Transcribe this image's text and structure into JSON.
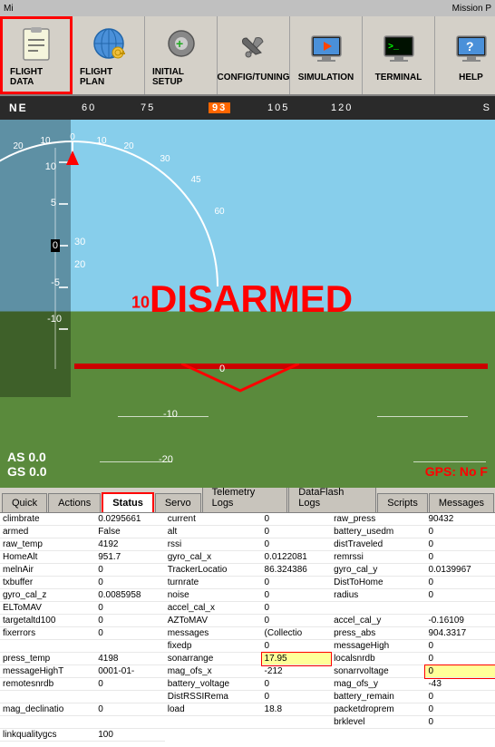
{
  "topbar": {
    "left": "Mi",
    "right": "Mission P"
  },
  "nav": {
    "items": [
      {
        "label": "FLIGHT DATA",
        "active": true,
        "icon": "clipboard"
      },
      {
        "label": "FLIGHT PLAN",
        "active": false,
        "icon": "globe"
      },
      {
        "label": "INITIAL SETUP",
        "active": false,
        "icon": "gear-plus"
      },
      {
        "label": "CONFIG/TUNING",
        "active": false,
        "icon": "wrench"
      },
      {
        "label": "SIMULATION",
        "active": false,
        "icon": "monitor"
      },
      {
        "label": "TERMINAL",
        "active": false,
        "icon": "terminal"
      },
      {
        "label": "HELP",
        "active": false,
        "icon": "help"
      }
    ]
  },
  "compass": {
    "markers": [
      "NE",
      "60",
      "75",
      "93",
      "105",
      "120"
    ],
    "highlighted": "93"
  },
  "attitude": {
    "status": "DISARMED",
    "status_prefix": "10",
    "horizon_label": "0",
    "pitch_labels": [
      "-20",
      "-10",
      "0",
      "10"
    ],
    "alt_labels": [
      "10",
      "5",
      "0",
      "-5",
      "-10"
    ],
    "airspeed": "AS 0.0",
    "groundspeed": "GS 0.0",
    "gps_status": "GPS: No F"
  },
  "tabs": [
    {
      "label": "Quick",
      "active": false
    },
    {
      "label": "Actions",
      "active": false
    },
    {
      "label": "Status",
      "active": true
    },
    {
      "label": "Servo",
      "active": false
    },
    {
      "label": "Telemetry Logs",
      "active": false
    },
    {
      "label": "DataFlash Logs",
      "active": false
    },
    {
      "label": "Scripts",
      "active": false
    },
    {
      "label": "Messages",
      "active": false
    }
  ],
  "status_data": [
    {
      "name": "climbrate",
      "value": "0.0295661"
    },
    {
      "name": "current",
      "value": "0"
    },
    {
      "name": "raw_press",
      "value": "90432"
    },
    {
      "name": "armed",
      "value": "False"
    },
    {
      "name": "alt",
      "value": "0"
    },
    {
      "name": "battery_usedm",
      "value": "0"
    },
    {
      "name": "raw_temp",
      "value": "4192"
    },
    {
      "name": "rssi",
      "value": "0"
    },
    {
      "name": "distTraveled",
      "value": "0"
    },
    {
      "name": "HomeAlt",
      "value": "951.7"
    },
    {
      "name": "gyro_cal_x",
      "value": "0.0122081"
    },
    {
      "name": "remrssi",
      "value": "0"
    },
    {
      "name": "melnAir",
      "value": "0"
    },
    {
      "name": "TrackerLocatio",
      "value": "86.324386"
    },
    {
      "name": "gyro_cal_y",
      "value": "0.0139967"
    },
    {
      "name": "txbuffer",
      "value": "0"
    },
    {
      "name": "turnrate",
      "value": "0"
    },
    {
      "name": "DistToHome",
      "value": "0"
    },
    {
      "name": "gyro_cal_z",
      "value": "0.0085958"
    },
    {
      "name": "noise",
      "value": "0"
    },
    {
      "name": "radius",
      "value": "0"
    },
    {
      "name": "ELToMAV",
      "value": "0"
    },
    {
      "name": "accel_cal_x",
      "value": "0"
    },
    {
      "name": "",
      "value": ""
    },
    {
      "name": "targetaltd100",
      "value": "0"
    },
    {
      "name": "AZToMAV",
      "value": "0"
    },
    {
      "name": "accel_cal_y",
      "value": "-0.16109"
    },
    {
      "name": "fixerrors",
      "value": "0"
    },
    {
      "name": "messages",
      "value": "(Collectio"
    },
    {
      "name": "press_abs",
      "value": "904.3317"
    },
    {
      "name": "",
      "value": ""
    },
    {
      "name": "fixedp",
      "value": "0"
    },
    {
      "name": "messageHigh",
      "value": "0"
    },
    {
      "name": "press_temp",
      "value": "4198"
    },
    {
      "name": "sonarrange",
      "value": "17.95"
    },
    {
      "name": "localsnrdb",
      "value": "0"
    },
    {
      "name": "messageHighT",
      "value": "0001-01-"
    },
    {
      "name": "mag_ofs_x",
      "value": "-212"
    },
    {
      "name": "sonarrvoltage",
      "value": "0"
    },
    {
      "name": "remotesnrdb",
      "value": "0"
    },
    {
      "name": "battery_voltage",
      "value": "0"
    },
    {
      "name": "mag_ofs_y",
      "value": "-43"
    },
    {
      "name": "",
      "value": ""
    },
    {
      "name": "DistRSSIRema",
      "value": "0"
    },
    {
      "name": "battery_remain",
      "value": "0"
    },
    {
      "name": "mag_declinatio",
      "value": "0"
    },
    {
      "name": "load",
      "value": "18.8"
    },
    {
      "name": "packetdroprem",
      "value": "0"
    },
    {
      "name": "",
      "value": ""
    },
    {
      "name": "",
      "value": ""
    },
    {
      "name": "brklevel",
      "value": "0"
    },
    {
      "name": "linkqualitygcs",
      "value": "100"
    }
  ]
}
